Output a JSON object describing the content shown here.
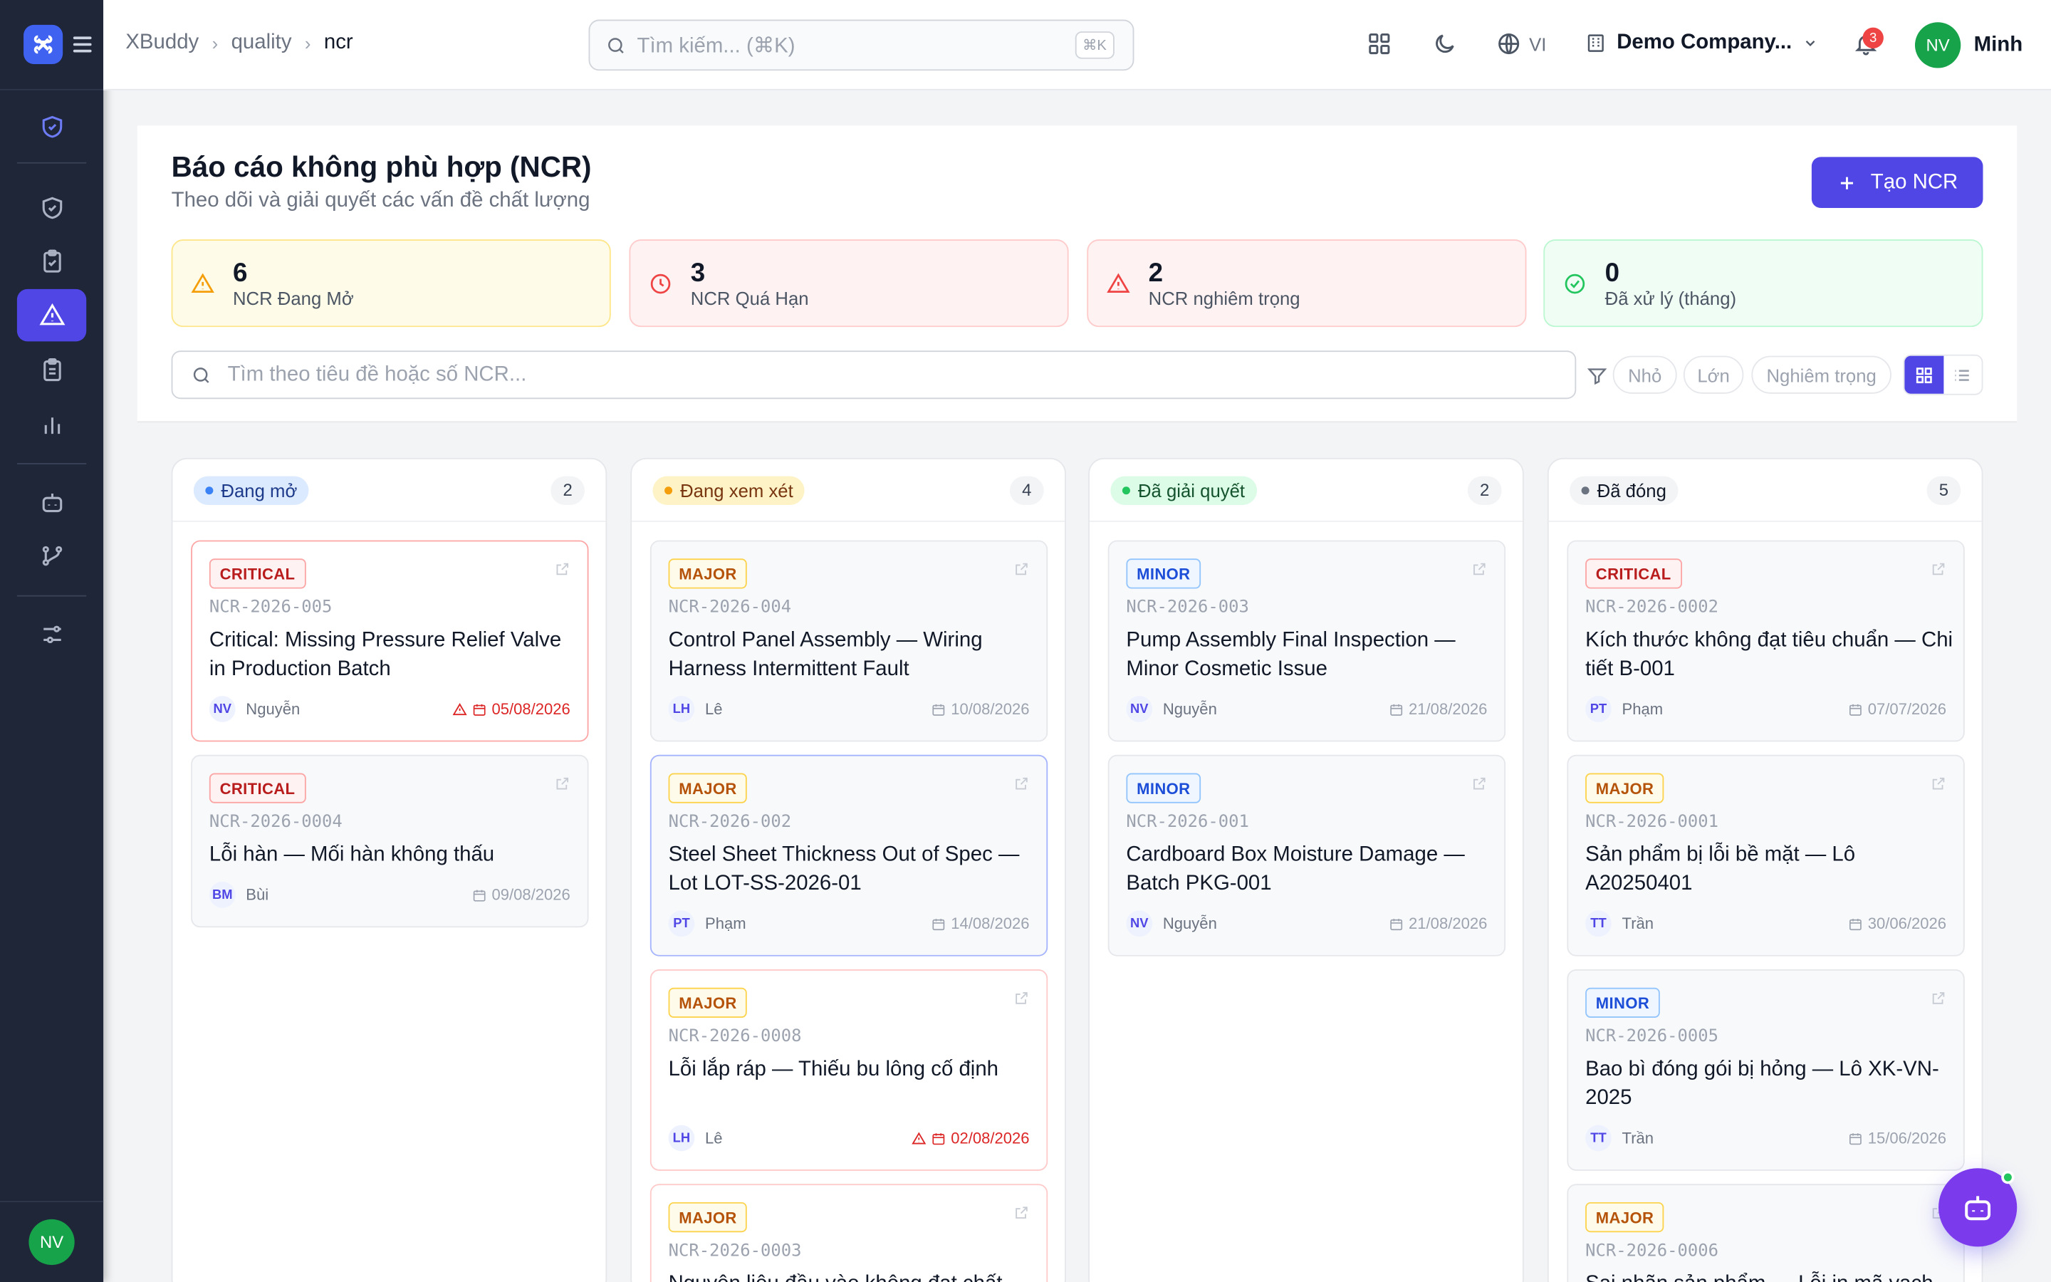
{
  "app": {
    "name": "XBuddy"
  },
  "breadcrumb": [
    "XBuddy",
    "quality",
    "ncr"
  ],
  "search": {
    "placeholder": "Tìm kiếm... (⌘K)",
    "shortcut": "⌘K"
  },
  "topbar": {
    "lang": "VI",
    "company": "Demo Company...",
    "notifications": "3",
    "user_initials": "NV",
    "user_name": "Minh"
  },
  "sidebar": {
    "avatar": "NV",
    "items": [
      "shield",
      "shield-check",
      "clipboard-check",
      "alert-triangle",
      "clipboard-list",
      "bar-chart",
      "bot",
      "git-branch",
      "sliders"
    ]
  },
  "page": {
    "title": "Báo cáo không phù hợp (NCR)",
    "subtitle": "Theo dõi và giải quyết các vấn đề chất lượng",
    "create_label": "Tạo NCR"
  },
  "stats": [
    {
      "value": "6",
      "label": "NCR Đang Mở",
      "color": "#f59e0b"
    },
    {
      "value": "3",
      "label": "NCR Quá Hạn",
      "color": "#ef4444"
    },
    {
      "value": "2",
      "label": "NCR nghiêm trọng",
      "color": "#ef4444"
    },
    {
      "value": "0",
      "label": "Đã xử lý (tháng)",
      "color": "#22c55e"
    }
  ],
  "filter": {
    "placeholder": "Tìm theo tiêu đề hoặc số NCR...",
    "chips": [
      "Nhỏ",
      "Lớn",
      "Nghiêm trọng"
    ]
  },
  "columns": [
    {
      "title": "Đang mở",
      "count": "2",
      "cards": [
        {
          "severity": "CRITICAL",
          "code": "NCR-2026-005",
          "title": "Critical: Missing Pressure Relief Valve in Production Batch",
          "initials": "NV",
          "owner": "Nguyễn",
          "date": "05/08/2026",
          "overdue": true
        },
        {
          "severity": "CRITICAL",
          "code": "NCR-2026-0004",
          "title": "Lỗi hàn — Mối hàn không thấu",
          "initials": "BM",
          "owner": "Bùi",
          "date": "09/08/2026",
          "overdue": false
        }
      ]
    },
    {
      "title": "Đang xem xét",
      "count": "4",
      "cards": [
        {
          "severity": "MAJOR",
          "code": "NCR-2026-004",
          "title": "Control Panel Assembly — Wiring Harness Intermittent Fault",
          "initials": "LH",
          "owner": "Lê",
          "date": "10/08/2026",
          "overdue": false
        },
        {
          "severity": "MAJOR",
          "code": "NCR-2026-002",
          "title": "Steel Sheet Thickness Out of Spec — Lot LOT-SS-2026-01",
          "initials": "PT",
          "owner": "Phạm",
          "date": "14/08/2026",
          "overdue": false
        },
        {
          "severity": "MAJOR",
          "code": "NCR-2026-0008",
          "title": "Lỗi lắp ráp — Thiếu bu lông cố định",
          "initials": "LH",
          "owner": "Lê",
          "date": "02/08/2026",
          "overdue": true
        },
        {
          "severity": "MAJOR",
          "code": "NCR-2026-0003",
          "title": "Nguyên liệu đầu vào không đạt chất lượng",
          "initials": "",
          "owner": "",
          "date": "",
          "overdue": false
        }
      ]
    },
    {
      "title": "Đã giải quyết",
      "count": "2",
      "cards": [
        {
          "severity": "MINOR",
          "code": "NCR-2026-003",
          "title": "Pump Assembly Final Inspection — Minor Cosmetic Issue",
          "initials": "NV",
          "owner": "Nguyễn",
          "date": "21/08/2026",
          "overdue": false
        },
        {
          "severity": "MINOR",
          "code": "NCR-2026-001",
          "title": "Cardboard Box Moisture Damage — Batch PKG-001",
          "initials": "NV",
          "owner": "Nguyễn",
          "date": "21/08/2026",
          "overdue": false
        }
      ]
    },
    {
      "title": "Đã đóng",
      "count": "5",
      "cards": [
        {
          "severity": "CRITICAL",
          "code": "NCR-2026-0002",
          "title": "Kích thước không đạt tiêu chuẩn — Chi tiết B-001",
          "initials": "PT",
          "owner": "Phạm",
          "date": "07/07/2026",
          "overdue": false
        },
        {
          "severity": "MAJOR",
          "code": "NCR-2026-0001",
          "title": "Sản phẩm bị lỗi bề mặt — Lô A20250401",
          "initials": "TT",
          "owner": "Trần",
          "date": "30/06/2026",
          "overdue": false
        },
        {
          "severity": "MINOR",
          "code": "NCR-2026-0005",
          "title": "Bao bì đóng gói bị hỏng — Lô XK-VN-2025",
          "initials": "TT",
          "owner": "Trần",
          "date": "15/06/2026",
          "overdue": false
        },
        {
          "severity": "MAJOR",
          "code": "NCR-2026-0006",
          "title": "Sai nhãn sản phẩm — Lỗi in mã vạch",
          "initials": "",
          "owner": "",
          "date": "",
          "overdue": false
        }
      ]
    }
  ]
}
